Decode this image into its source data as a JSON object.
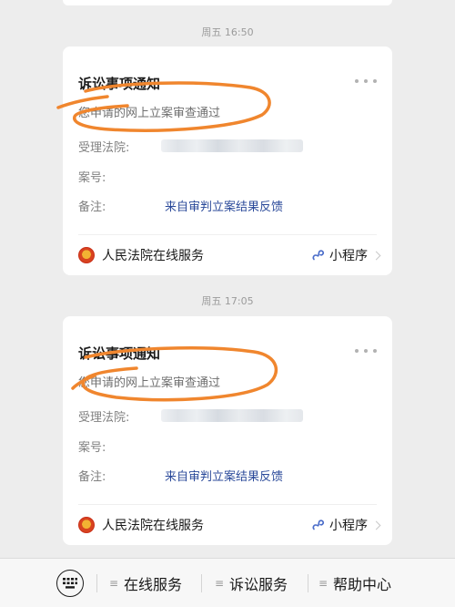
{
  "messages": [
    {
      "timestamp": "周五 16:50",
      "title": "诉讼事项通知",
      "subtitle": "您申请的网上立案审查通过",
      "court_label": "受理法院:",
      "case_label": "案号:",
      "note_label": "备注:",
      "note_value": "来自审判立案结果反馈",
      "service_name": "人民法院在线服务",
      "mini_program_label": "小程序"
    },
    {
      "timestamp": "周五 17:05",
      "title": "诉讼事项通知",
      "subtitle": "您申请的网上立案审查通过",
      "court_label": "受理法院:",
      "case_label": "案号:",
      "note_label": "备注:",
      "note_value": "来自审判立案结果反馈",
      "service_name": "人民法院在线服务",
      "mini_program_label": "小程序"
    }
  ],
  "bottom_menu": {
    "items": [
      "在线服务",
      "诉讼服务",
      "帮助中心"
    ]
  },
  "colors": {
    "annotation_stroke": "#f0862e",
    "link_blue": "#2b4a9a"
  }
}
